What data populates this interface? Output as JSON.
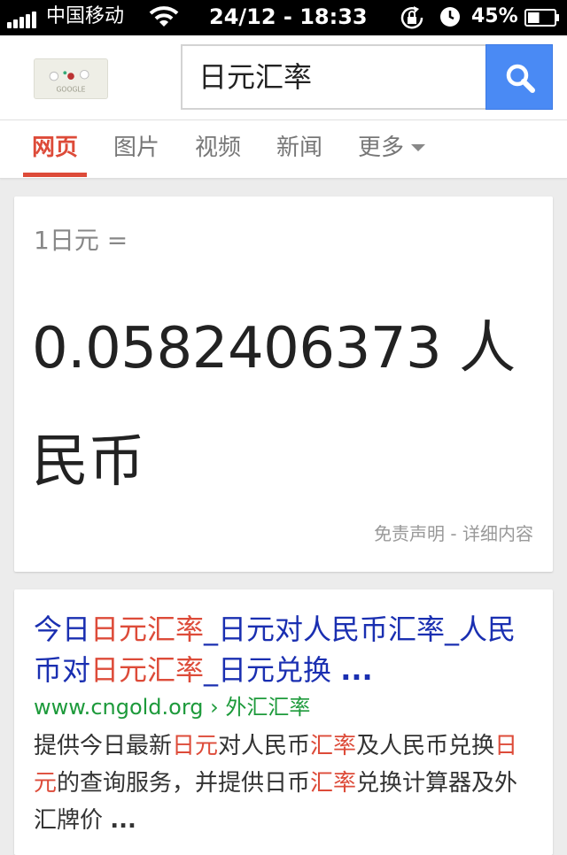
{
  "status_bar": {
    "carrier": "中国移动",
    "datetime": "24/12 - 18:33",
    "battery_percent": "45%",
    "battery_level": 0.45,
    "icons": [
      "signal-icon",
      "wifi-icon",
      "rotation-lock-icon",
      "alarm-icon",
      "battery-icon"
    ]
  },
  "header": {
    "logo_text": "GOOGLE",
    "search_query": "日元汇率",
    "search_button_icon": "search-icon",
    "accent_color": "#4a8af4"
  },
  "tabs": [
    {
      "label": "网页",
      "active": true
    },
    {
      "label": "图片",
      "active": false
    },
    {
      "label": "视频",
      "active": false
    },
    {
      "label": "新闻",
      "active": false
    },
    {
      "label": "更多",
      "active": false,
      "has_dropdown": true
    }
  ],
  "currency": {
    "from": "1日元 =",
    "result": "0.0582406373 人民币",
    "disclaimer": "免责声明 - 详细内容"
  },
  "result": {
    "title_segments": [
      {
        "text": "今日",
        "hl": false
      },
      {
        "text": "日元汇率",
        "hl": true
      },
      {
        "text": "_日元对人民币汇率_人民币对",
        "hl": false
      },
      {
        "text": "日元汇率",
        "hl": true
      },
      {
        "text": "_日元兑换 ",
        "hl": false
      },
      {
        "text": "...",
        "hl": false,
        "bold": true
      }
    ],
    "url": "www.cngold.org › 外汇汇率",
    "snippet_segments": [
      {
        "text": "提供今日最新",
        "hl": false
      },
      {
        "text": "日元",
        "hl": true
      },
      {
        "text": "对人民币",
        "hl": false
      },
      {
        "text": "汇率",
        "hl": true
      },
      {
        "text": "及人民币兑换",
        "hl": false
      },
      {
        "text": "日元",
        "hl": true
      },
      {
        "text": "的查询服务，并提供日币",
        "hl": false
      },
      {
        "text": "汇率",
        "hl": true
      },
      {
        "text": "兑换计算器及外汇牌价 ",
        "hl": false
      },
      {
        "text": "...",
        "hl": false,
        "bold": true
      }
    ],
    "title_color": "#1a2fb1",
    "highlight_color": "#dd4b39",
    "url_color": "#1d9a3b"
  }
}
